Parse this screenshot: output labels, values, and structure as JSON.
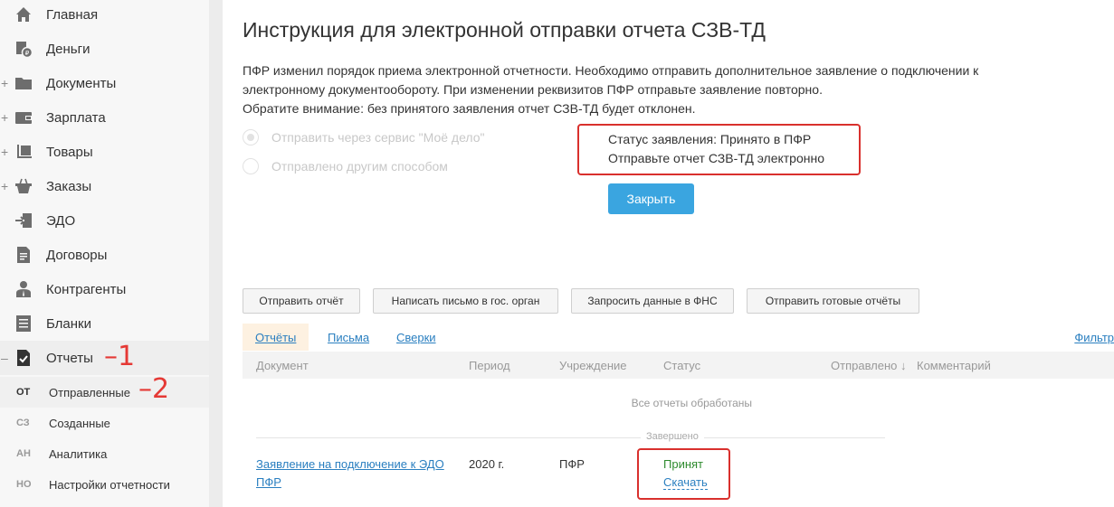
{
  "sidebar": {
    "items": [
      {
        "label": "Главная",
        "icon": "home-icon",
        "expandable": false
      },
      {
        "label": "Деньги",
        "icon": "money-icon",
        "expandable": false
      },
      {
        "label": "Документы",
        "icon": "folder-icon",
        "expandable": true
      },
      {
        "label": "Зарплата",
        "icon": "wallet-icon",
        "expandable": true
      },
      {
        "label": "Товары",
        "icon": "cart-icon",
        "expandable": true
      },
      {
        "label": "Заказы",
        "icon": "basket-icon",
        "expandable": true
      },
      {
        "label": "ЭДО",
        "icon": "edo-icon",
        "expandable": false
      },
      {
        "label": "Договоры",
        "icon": "contract-icon",
        "expandable": false
      },
      {
        "label": "Контрагенты",
        "icon": "contractor-icon",
        "expandable": false
      },
      {
        "label": "Бланки",
        "icon": "forms-icon",
        "expandable": false
      },
      {
        "label": "Отчеты",
        "icon": "report-check-icon",
        "expandable": true,
        "expanded": true,
        "expand_symbol": "–"
      }
    ],
    "plus_symbol": "+",
    "subitems": [
      {
        "abbr": "ОТ",
        "label": "Отправленные"
      },
      {
        "abbr": "СЗ",
        "label": "Созданные"
      },
      {
        "abbr": "АН",
        "label": "Аналитика"
      },
      {
        "abbr": "НО",
        "label": "Настройки отчетности"
      }
    ],
    "annotations": [
      "–1",
      "–2"
    ]
  },
  "main": {
    "title": "Инструкция для электронной отправки отчета СЗВ-ТД",
    "description_lines": [
      "ПФР изменил порядок приема электронной отчетности. Необходимо отправить дополнительное заявление о подключении к",
      "электронному документообороту. При изменении реквизитов ПФР отправьте заявление повторно.",
      "Обратите внимание: без принятого заявления отчет СЗВ-ТД будет отклонен."
    ],
    "radio_options": [
      {
        "label": "Отправить через сервис \"Моё дело\"",
        "checked": true
      },
      {
        "label": "Отправлено другим способом",
        "checked": false
      }
    ],
    "status_lines": [
      "Статус заявления: Принято в ПФР",
      "Отправьте отчет СЗВ-ТД электронно"
    ],
    "close_label": "Закрыть",
    "toolbar": [
      "Отправить отчёт",
      "Написать письмо в гос. орган",
      "Запросить данные в ФНС",
      "Отправить готовые отчёты"
    ],
    "tabs": [
      "Отчёты",
      "Письма",
      "Сверки"
    ],
    "filter_label": "Фильтр",
    "table": {
      "headers": [
        "Документ",
        "Период",
        "Учреждение",
        "Статус",
        "Отправлено ↓",
        "Комментарий"
      ],
      "all_done": "Все отчеты обработаны",
      "group_label": "Завершено",
      "rows": [
        {
          "doc_line1": "Заявление на подключение к ЭДО",
          "doc_line2": "ПФР",
          "period": "2020 г.",
          "institution": "ПФР",
          "status": "Принят",
          "download": "Скачать"
        }
      ]
    }
  },
  "colors": {
    "accent_blue": "#3aa5e0",
    "link": "#2a7fc0",
    "annotation_red": "#d9302d",
    "status_green": "#2e8b2e"
  }
}
